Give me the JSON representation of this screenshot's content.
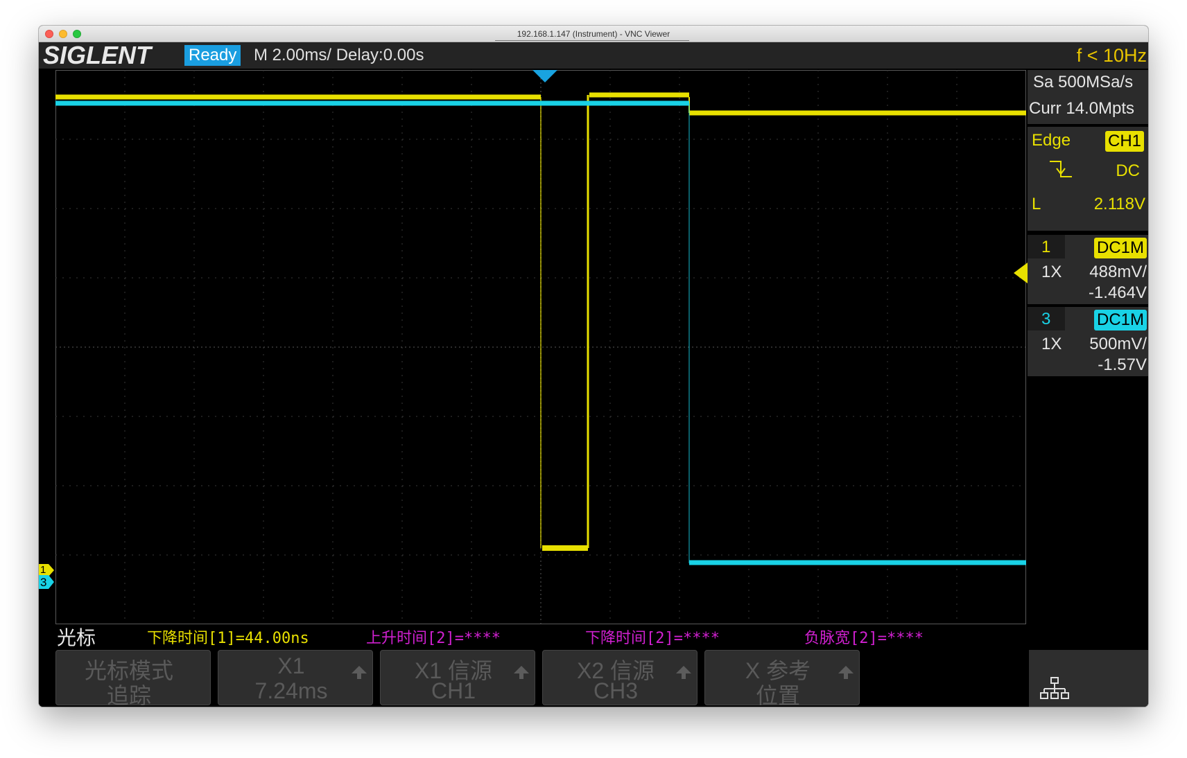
{
  "window": {
    "title": "192.168.1.147 (Instrument) - VNC Viewer"
  },
  "header": {
    "logo": "SIGLENT",
    "status": "Ready",
    "timebase": "M 2.00ms/ Delay:0.00s",
    "freq": "f < 10Hz"
  },
  "acquisition": {
    "sample_rate": "Sa 500MSa/s",
    "memory": "Curr 14.0Mpts"
  },
  "trigger": {
    "type": "Edge",
    "source": "CH1",
    "slope_icon": "falling-edge-icon",
    "coupling": "DC",
    "level_label": "L",
    "level": "2.118V"
  },
  "channels": [
    {
      "num": "1",
      "coupling": "DC1M",
      "probe": "1X",
      "scale": "488mV/",
      "offset": "-1.464V",
      "color": "#e8e000"
    },
    {
      "num": "3",
      "coupling": "DC1M",
      "probe": "1X",
      "scale": "500mV/",
      "offset": "-1.57V",
      "color": "#19d2e6"
    }
  ],
  "markers": {
    "ch1": "1",
    "ch3": "3"
  },
  "measurements": {
    "section_label": "光标",
    "items": [
      {
        "text": "下降时间[1]=44.00ns",
        "color": "#e8e000"
      },
      {
        "text": "上升时间[2]=****",
        "color": "#d020d0"
      },
      {
        "text": "下降时间[2]=****",
        "color": "#d020d0"
      },
      {
        "text": "负脉宽[2]=****",
        "color": "#d020d0"
      }
    ]
  },
  "softkeys": [
    {
      "line1": "光标模式",
      "line2": "追踪",
      "arrow": false
    },
    {
      "line1": "X1",
      "line2": "7.24ms",
      "arrow": true
    },
    {
      "line1": "X1 信源",
      "line2": "CH1",
      "arrow": true
    },
    {
      "line1": "X2 信源",
      "line2": "CH3",
      "arrow": true
    },
    {
      "line1": "X 参考",
      "line2": "位置",
      "arrow": true
    }
  ],
  "colors": {
    "ch1": "#e8e000",
    "ch3": "#19d2e6",
    "status": "#1a9ee0",
    "measure_magenta": "#d020d0"
  },
  "icons": {
    "network": "network-icon"
  }
}
